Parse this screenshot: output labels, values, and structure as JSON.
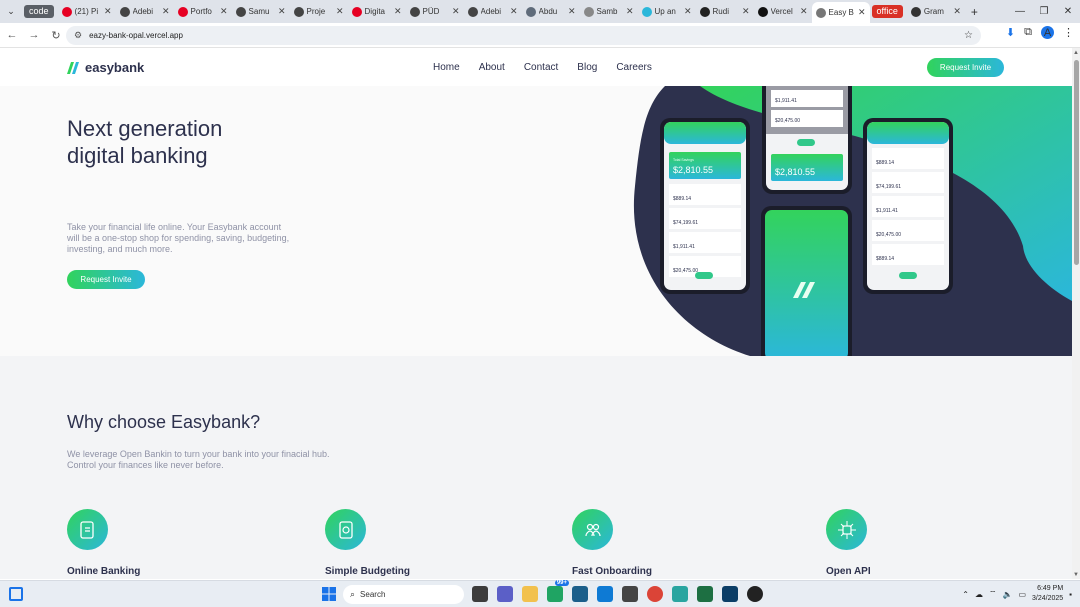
{
  "browser": {
    "tab_groups": [
      {
        "label": "code"
      },
      {
        "label": "office"
      }
    ],
    "tabs": [
      {
        "title": "(21) Pi",
        "color": "#e60023"
      },
      {
        "title": "Adebi",
        "color": "#444444"
      },
      {
        "title": "Portfo",
        "color": "#e60023"
      },
      {
        "title": "Samu",
        "color": "#444444"
      },
      {
        "title": "Proje",
        "color": "#444444"
      },
      {
        "title": "Digita",
        "color": "#e60023"
      },
      {
        "title": "PÜD",
        "color": "#444444"
      },
      {
        "title": "Adebi",
        "color": "#444444"
      },
      {
        "title": "Abdu",
        "color": "#5f6b7a"
      },
      {
        "title": "Samb",
        "color": "#888888"
      },
      {
        "title": "Up an",
        "color": "#2bb7da"
      },
      {
        "title": "Rudi",
        "color": "#222222"
      },
      {
        "title": "Vercel",
        "color": "#111111"
      },
      {
        "title": "Easy B",
        "color": "#777777"
      },
      {
        "title": "Gram",
        "color": "#333333"
      }
    ],
    "url": "eazy-bank-opal.vercel.app",
    "profile_initial": "A"
  },
  "site": {
    "brand": "easybank",
    "nav": [
      "Home",
      "About",
      "Contact",
      "Blog",
      "Careers"
    ],
    "cta": "Request Invite"
  },
  "hero": {
    "title_line1": "Next generation",
    "title_line2": "digital banking",
    "body": "Take your financial life online. Your Easybank account will be a one-stop shop for spending, saving, budgeting, investing, and much more.",
    "cta": "Request Invite"
  },
  "phones": {
    "left": {
      "balance_label": "Total Savings",
      "balance": "$2,810.55",
      "rows": [
        "$889.14",
        "$74,199.61",
        "$1,911.41",
        "$20,475.00"
      ]
    },
    "middle": {
      "rows": [
        "$1,911.41",
        "$20,475.00"
      ],
      "balance": "$2,810.55"
    },
    "right": {
      "rows": [
        "$889.14",
        "$74,199.61",
        "$1,911.41",
        "$20,475.00",
        "$889.14"
      ]
    }
  },
  "why": {
    "title": "Why choose Easybank?",
    "body": "We leverage Open Bankin to turn your bank into your finacial hub. Control your finances like never before.",
    "features": [
      "Online Banking",
      "Simple Budgeting",
      "Fast Onboarding",
      "Open API"
    ]
  },
  "taskbar": {
    "search": "Search",
    "badge": "99+",
    "time": "6:49 PM",
    "date": "3/24/2025"
  },
  "colors": {
    "primary": "#2d314d",
    "green": "#31d35c",
    "cyan": "#2bb7da",
    "gray_text": "#8f92a6"
  }
}
